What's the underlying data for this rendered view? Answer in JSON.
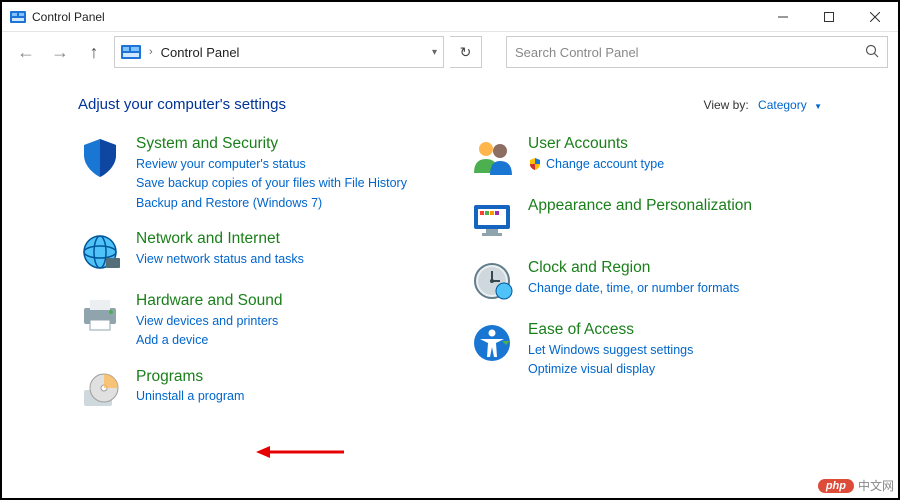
{
  "window": {
    "title": "Control Panel"
  },
  "address": {
    "root": "Control Panel"
  },
  "search": {
    "placeholder": "Search Control Panel"
  },
  "heading": "Adjust your computer's settings",
  "viewby": {
    "label": "View by:",
    "value": "Category"
  },
  "left": [
    {
      "title": "System and Security",
      "links": [
        "Review your computer's status",
        "Save backup copies of your files with File History",
        "Backup and Restore (Windows 7)"
      ]
    },
    {
      "title": "Network and Internet",
      "links": [
        "View network status and tasks"
      ]
    },
    {
      "title": "Hardware and Sound",
      "links": [
        "View devices and printers",
        "Add a device"
      ]
    },
    {
      "title": "Programs",
      "links": [
        "Uninstall a program"
      ]
    }
  ],
  "right": [
    {
      "title": "User Accounts",
      "links": [
        "Change account type"
      ],
      "shield": [
        0
      ]
    },
    {
      "title": "Appearance and Personalization",
      "links": []
    },
    {
      "title": "Clock and Region",
      "links": [
        "Change date, time, or number formats"
      ]
    },
    {
      "title": "Ease of Access",
      "links": [
        "Let Windows suggest settings",
        "Optimize visual display"
      ]
    }
  ],
  "watermark": {
    "badge": "php",
    "text": "中文网"
  }
}
